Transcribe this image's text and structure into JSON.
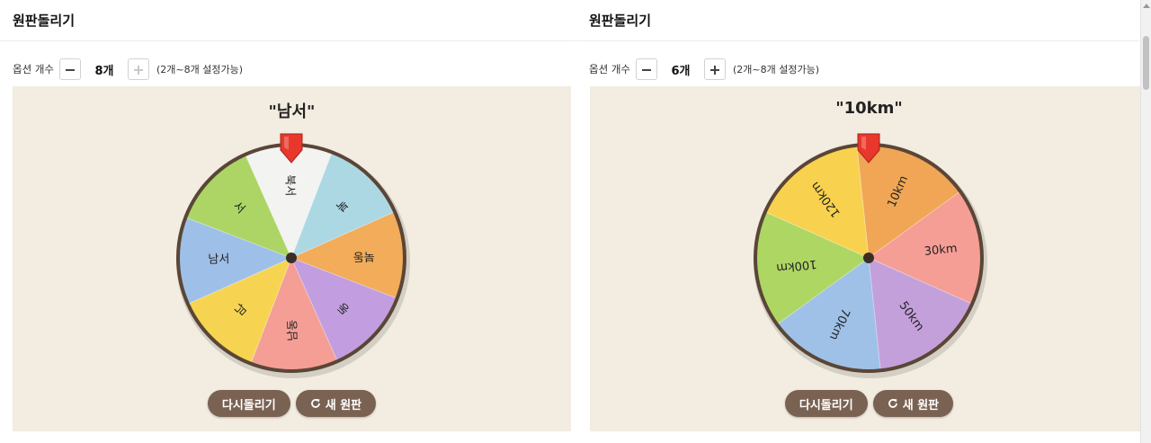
{
  "panels": [
    {
      "title": "원판돌리기",
      "option_count_label": "옵션 개수",
      "count": "8개",
      "range_hint": "(2개~8개 설정가능)",
      "result": "\"남서\"",
      "respin_label": "다시돌리기",
      "new_wheel_label": "새 원판",
      "segments": [
        {
          "label": "북",
          "color": "#acd8e3"
        },
        {
          "label": "북동",
          "color": "#f2ac5a"
        },
        {
          "label": "동",
          "color": "#c29ee0"
        },
        {
          "label": "남동",
          "color": "#f49e96"
        },
        {
          "label": "남",
          "color": "#f6d452"
        },
        {
          "label": "남서",
          "color": "#9ec0e8"
        },
        {
          "label": "서",
          "color": "#acd565"
        },
        {
          "label": "북서",
          "color": "#f3f3f1"
        }
      ],
      "start_angle_deg": 21,
      "text_upside_down": true,
      "minus_disabled": false,
      "plus_disabled": true
    },
    {
      "title": "원판돌리기",
      "option_count_label": "옵션 개수",
      "count": "6개",
      "range_hint": "(2개~8개 설정가능)",
      "result": "\"10km\"",
      "respin_label": "다시돌리기",
      "new_wheel_label": "새 원판",
      "segments": [
        {
          "label": "10km",
          "color": "#f0a654"
        },
        {
          "label": "30km",
          "color": "#f59e95"
        },
        {
          "label": "50km",
          "color": "#c4a0db"
        },
        {
          "label": "70km",
          "color": "#9fc1e8"
        },
        {
          "label": "100km",
          "color": "#aed663"
        },
        {
          "label": "120km",
          "color": "#f8d24f"
        }
      ],
      "start_angle_deg": -6,
      "text_upside_down": false,
      "minus_disabled": false,
      "plus_disabled": false
    }
  ],
  "colors": {
    "stage_bg": "#f2ece1",
    "wheel_rim": "#5a4636",
    "pointer": "#e8372b",
    "button_bg": "#7a6252"
  }
}
